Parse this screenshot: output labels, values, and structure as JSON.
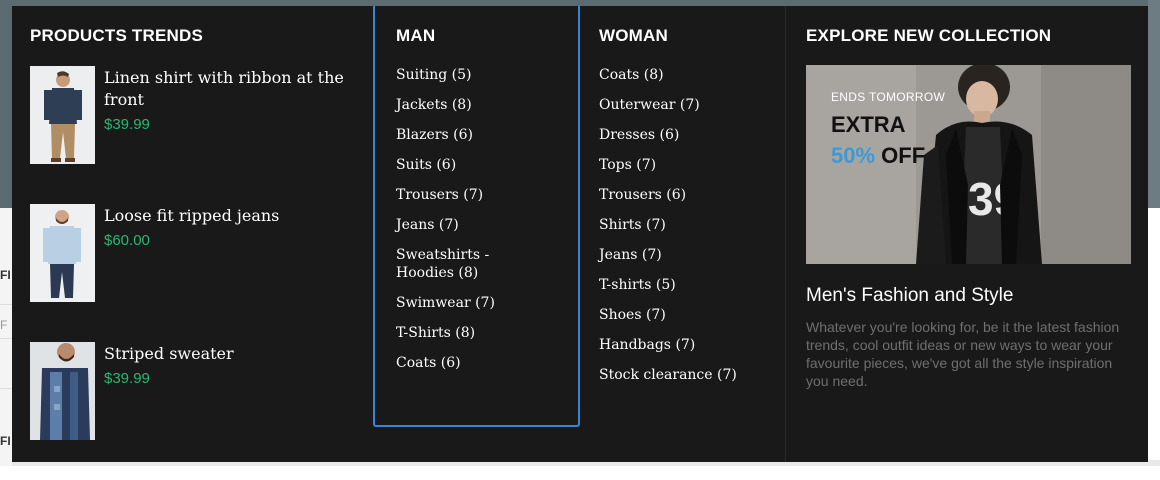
{
  "background": {
    "left_fragments": [
      "FI",
      "F",
      "FI"
    ]
  },
  "menu": {
    "trends": {
      "heading": "PRODUCTS TRENDS",
      "products": [
        {
          "name": "Linen shirt with ribbon at the front",
          "price": "$39.99"
        },
        {
          "name": "Loose fit ripped jeans",
          "price": "$60.00"
        },
        {
          "name": "Striped sweater",
          "price": "$39.99"
        }
      ]
    },
    "man": {
      "heading": "MAN",
      "items": [
        "Suiting (5)",
        "Jackets (8)",
        "Blazers (6)",
        "Suits (6)",
        "Trousers (7)",
        "Jeans (7)",
        "Sweatshirts - Hoodies (8)",
        "Swimwear (7)",
        "T-Shirts (8)",
        "Coats (6)"
      ]
    },
    "woman": {
      "heading": "WOMAN",
      "items": [
        "Coats (8)",
        "Outerwear (7)",
        "Dresses (6)",
        "Tops (7)",
        "Trousers (6)",
        "Shirts (7)",
        "Jeans (7)",
        "T-shirts (5)",
        "Shoes (7)",
        "Handbags (7)",
        "Stock clearance (7)"
      ]
    },
    "explore": {
      "heading": "EXPLORE NEW COLLECTION",
      "promo": {
        "ends": "ENDS TOMORROW",
        "extra": "EXTRA",
        "percent": "50%",
        "off": "OFF"
      },
      "title": "Men's Fashion and Style",
      "text": "Whatever you're looking for, be it the latest fashion trends, cool outfit ideas or new ways to wear your favourite pieces, we've got all the style inspiration you need."
    }
  },
  "colors": {
    "menu_bg": "#1a1919",
    "price": "#2bb673",
    "accent": "#3a86d6",
    "promo_percent": "#3a9ad9"
  }
}
